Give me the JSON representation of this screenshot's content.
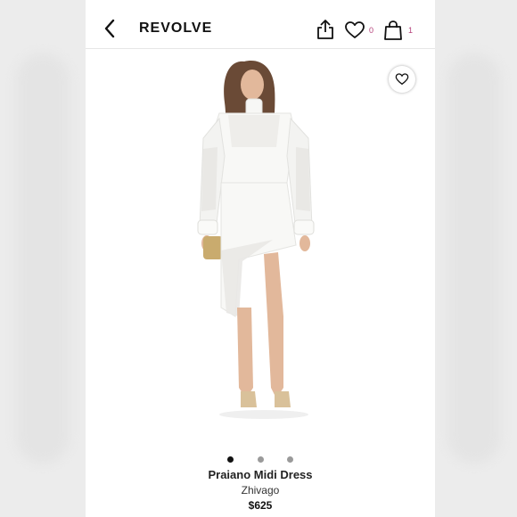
{
  "status_bar": {
    "time": ""
  },
  "nav": {
    "back_icon": "chevron-left-icon",
    "brand": "REVOLVE",
    "share_icon": "share-icon",
    "wishlist_icon": "heart-icon",
    "wishlist_count": "0",
    "bag_icon": "shopping-bag-icon",
    "bag_count": "1",
    "count_color": "#b5417a"
  },
  "product": {
    "image_alt": "Model wearing white lace asymmetric midi dress",
    "name": "Praiano Midi Dress",
    "designer": "Zhivago",
    "price": "$625",
    "installments_text": "",
    "image_count": 3,
    "active_image": 0
  }
}
